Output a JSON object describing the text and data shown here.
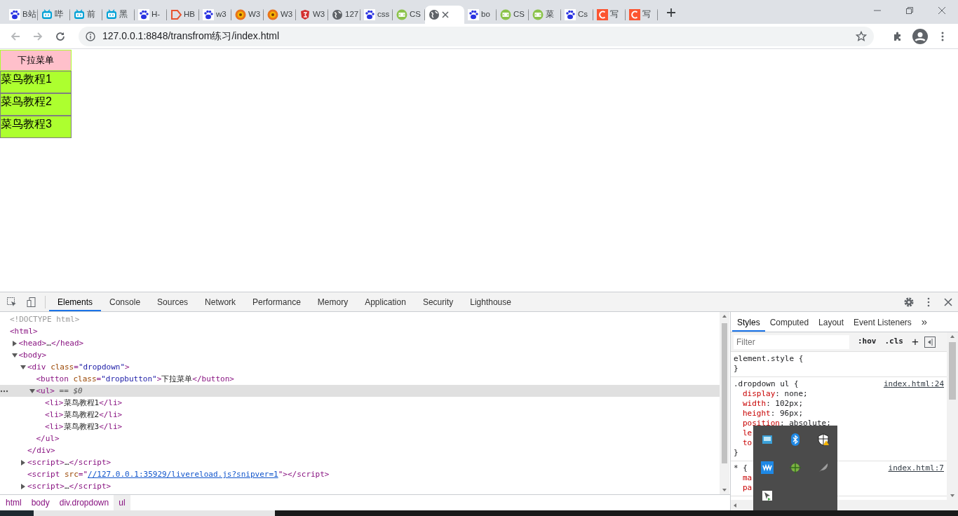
{
  "browser": {
    "tabs": [
      {
        "kind": "paw",
        "title": "B站",
        "selected": false
      },
      {
        "kind": "tv",
        "title": "哔",
        "selected": false
      },
      {
        "kind": "tv",
        "title": "前",
        "selected": false
      },
      {
        "kind": "tv",
        "title": "黑",
        "selected": false
      },
      {
        "kind": "paw",
        "title": "H-",
        "selected": false
      },
      {
        "kind": "play",
        "title": "HB",
        "selected": false
      },
      {
        "kind": "paw",
        "title": "w3",
        "selected": false
      },
      {
        "kind": "lion",
        "title": "W3",
        "selected": false
      },
      {
        "kind": "lion",
        "title": "W3",
        "selected": false
      },
      {
        "kind": "shield",
        "title": "W3",
        "selected": false
      },
      {
        "kind": "globe",
        "title": "127",
        "selected": false
      },
      {
        "kind": "paw",
        "title": "css",
        "selected": false
      },
      {
        "kind": "code",
        "title": "CS",
        "selected": false
      },
      {
        "kind": "globe",
        "selected": true
      },
      {
        "kind": "paw",
        "title": "bo",
        "selected": false
      },
      {
        "kind": "code",
        "title": "CS",
        "selected": false
      },
      {
        "kind": "code",
        "title": "菜",
        "selected": false
      },
      {
        "kind": "paw",
        "title": "Cs",
        "selected": false
      },
      {
        "kind": "c",
        "title": "写",
        "selected": false
      },
      {
        "kind": "c",
        "title": "写",
        "selected": false
      }
    ],
    "address": "127.0.0.1:8848/transfrom练习/index.html",
    "back_disabled": true,
    "forward_disabled": true
  },
  "page": {
    "button": "下拉菜单",
    "items": [
      "菜鸟教程1",
      "菜鸟教程2",
      "菜鸟教程3"
    ]
  },
  "devtools": {
    "tabs": [
      {
        "label": "Elements",
        "selected": true
      },
      {
        "label": "Console",
        "selected": false
      },
      {
        "label": "Sources",
        "selected": false
      },
      {
        "label": "Network",
        "selected": false
      },
      {
        "label": "Performance",
        "selected": false
      },
      {
        "label": "Memory",
        "selected": false
      },
      {
        "label": "Application",
        "selected": false
      },
      {
        "label": "Security",
        "selected": false
      },
      {
        "label": "Lighthouse",
        "selected": false
      }
    ],
    "dom": [
      {
        "selected": false,
        "tokens": [
          {
            "kind": "dim",
            "text": "<!DOCTYPE html>"
          }
        ]
      },
      {
        "selected": false,
        "tokens": [
          {
            "kind": "tag",
            "text": "<html>"
          }
        ],
        "children": [
          {
            "selected": false,
            "expanded": false,
            "tokens": [
              {
                "kind": "tag",
                "text": "<head>"
              },
              {
                "kind": "text",
                "text": "…"
              },
              {
                "kind": "tag",
                "text": "</head>"
              }
            ]
          },
          {
            "selected": false,
            "expanded": true,
            "tokens": [
              {
                "kind": "tag",
                "text": "<body>"
              }
            ],
            "children": [
              {
                "selected": false,
                "expanded": true,
                "tokens": [
                  {
                    "kind": "tag",
                    "text": "<div "
                  },
                  {
                    "kind": "attr",
                    "text": "class"
                  },
                  {
                    "kind": "tag",
                    "text": "="
                  },
                  {
                    "kind": "val",
                    "text": "\"dropdown\""
                  },
                  {
                    "kind": "tag",
                    "text": ">"
                  }
                ],
                "close": [
                  {
                    "kind": "tag",
                    "text": "</div>"
                  }
                ],
                "children": [
                  {
                    "selected": false,
                    "tokens": [
                      {
                        "kind": "tag",
                        "text": "<button "
                      },
                      {
                        "kind": "attr",
                        "text": "class"
                      },
                      {
                        "kind": "tag",
                        "text": "="
                      },
                      {
                        "kind": "val",
                        "text": "\"dropbutton\""
                      },
                      {
                        "kind": "tag",
                        "text": ">"
                      },
                      {
                        "kind": "text",
                        "text": "下拉菜单"
                      },
                      {
                        "kind": "tag",
                        "text": "</button>"
                      }
                    ]
                  },
                  {
                    "selected": true,
                    "expanded": true,
                    "tokens": [
                      {
                        "kind": "tag",
                        "text": "<ul>"
                      },
                      {
                        "kind": "marker",
                        "text": " == $0"
                      }
                    ],
                    "close": [
                      {
                        "kind": "tag",
                        "text": "</ul>"
                      }
                    ],
                    "children": [
                      {
                        "selected": false,
                        "tokens": [
                          {
                            "kind": "tag",
                            "text": "<li>"
                          },
                          {
                            "kind": "text",
                            "text": "菜鸟教程1"
                          },
                          {
                            "kind": "tag",
                            "text": "</li>"
                          }
                        ]
                      },
                      {
                        "selected": false,
                        "tokens": [
                          {
                            "kind": "tag",
                            "text": "<li>"
                          },
                          {
                            "kind": "text",
                            "text": "菜鸟教程2"
                          },
                          {
                            "kind": "tag",
                            "text": "</li>"
                          }
                        ]
                      },
                      {
                        "selected": false,
                        "tokens": [
                          {
                            "kind": "tag",
                            "text": "<li>"
                          },
                          {
                            "kind": "text",
                            "text": "菜鸟教程3"
                          },
                          {
                            "kind": "tag",
                            "text": "</li>"
                          }
                        ]
                      }
                    ]
                  }
                ]
              },
              {
                "selected": false,
                "expanded": false,
                "tokens": [
                  {
                    "kind": "tag",
                    "text": "<script>"
                  },
                  {
                    "kind": "text",
                    "text": "…"
                  },
                  {
                    "kind": "tag",
                    "text": "</script>"
                  }
                ]
              },
              {
                "selected": false,
                "tokens": [
                  {
                    "kind": "tag",
                    "text": "<script "
                  },
                  {
                    "kind": "attr",
                    "text": "src"
                  },
                  {
                    "kind": "tag",
                    "text": "=\""
                  },
                  {
                    "kind": "link",
                    "text": "//127.0.0.1:35929/livereload.js?snipver=1"
                  },
                  {
                    "kind": "tag",
                    "text": "\"></script>"
                  }
                ]
              },
              {
                "selected": false,
                "expanded": false,
                "tokens": [
                  {
                    "kind": "tag",
                    "text": "<script>"
                  },
                  {
                    "kind": "text",
                    "text": "…"
                  },
                  {
                    "kind": "tag",
                    "text": "</script>"
                  }
                ]
              }
            ]
          }
        ]
      }
    ],
    "breadcrumbs": [
      {
        "label": "html",
        "selected": false
      },
      {
        "label": "body",
        "selected": false
      },
      {
        "label": "div.dropdown",
        "selected": false
      },
      {
        "label": "ul",
        "selected": true
      }
    ],
    "styles": {
      "tabs": [
        {
          "label": "Styles",
          "selected": true
        },
        {
          "label": "Computed",
          "selected": false
        },
        {
          "label": "Layout",
          "selected": false
        },
        {
          "label": "Event Listeners",
          "selected": false
        }
      ],
      "more": "»",
      "filter": {
        "placeholder": "Filter"
      },
      "hov": ":hov",
      "cls": ".cls",
      "add": "+",
      "rules": [
        {
          "selector": "element.style {",
          "close": "}"
        },
        {
          "selector": ".dropdown ul {",
          "source": "index.html:24",
          "close": "}",
          "props": [
            {
              "name": "display",
              "value": ": none;"
            },
            {
              "name": "width",
              "value": ": 102px;"
            },
            {
              "name": "height",
              "value": ": 96px;"
            },
            {
              "name": "position",
              "value": ": absolute;"
            },
            {
              "name": "le"
            },
            {
              "name": "to"
            }
          ]
        },
        {
          "selector": "* {",
          "source": "index.html:7",
          "props": [
            {
              "name": "ma"
            },
            {
              "name": "pa"
            }
          ]
        }
      ]
    }
  }
}
